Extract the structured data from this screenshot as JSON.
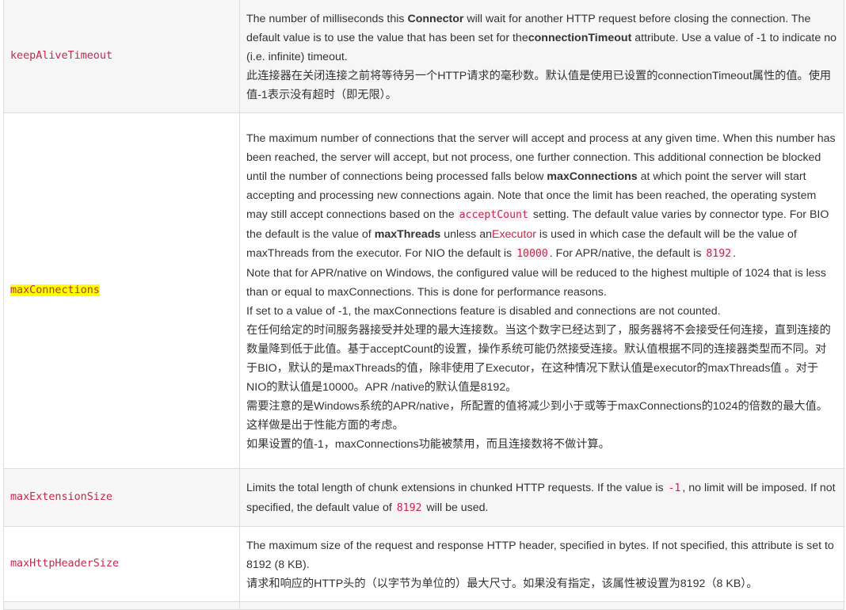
{
  "rows": [
    {
      "name": "keepAliveTimeout",
      "en_1": "The number of milliseconds this ",
      "en_b1": "Connector",
      "en_2": " will wait for another HTTP request before closing the connection. The default value is to use the value that has been set for the",
      "en_b2": "connectionTimeout",
      "en_3": " attribute. Use a value of -1 to indicate no (i.e. infinite) timeout.",
      "zh": "此连接器在关闭连接之前将等待另一个HTTP请求的毫秒数。默认值是使用已设置的connectionTimeout属性的值。使用值-1表示没有超时（即无限）。"
    },
    {
      "name": "maxConnections",
      "p1_a": "The maximum number of connections that the server will accept and process at any given time. When this number has been reached, the server will accept, but not process, one further connection. This additional connection be blocked until the number of connections being processed falls below ",
      "p1_b": "maxConnections",
      "p1_c": " at which point the server will start accepting and processing new connections again. Note that once the limit has been reached, the operating system may still accept connections based on the ",
      "p1_code": "acceptCount",
      "p1_d": " setting. The default value varies by connector type. For BIO the default is the value of ",
      "p1_e": "maxThreads",
      "p1_f": " unless an",
      "p1_link": "Executor",
      "p1_g": " is used in which case the default will be the value of maxThreads from the executor. For NIO the default is ",
      "p1_code2": "10000",
      "p1_h": ". For APR/native, the default is ",
      "p1_code3": "8192",
      "p1_i": ".",
      "p2": "Note that for APR/native on Windows, the configured value will be reduced to the highest multiple of 1024 that is less than or equal to maxConnections. This is done for performance reasons.",
      "p3": "If set to a value of -1, the maxConnections feature is disabled and connections are not counted.",
      "zh1": "在任何给定的时间服务器接受并处理的最大连接数。当这个数字已经达到了，服务器将不会接受任何连接，直到连接的数量降到低于此值。基于acceptCount的设置，操作系统可能仍然接受连接。默认值根据不同的连接器类型而不同。对于BIO，默认的是maxThreads的值，除非使用了Executor，在这种情况下默认值是executor的maxThreads值 。对于NIO的默认值是10000。APR /native的默认值是8192。",
      "zh2": "需要注意的是Windows系统的APR/native，所配置的值将减少到小于或等于maxConnections的1024的倍数的最大值。这样做是出于性能方面的考虑。",
      "zh3": "如果设置的值-1，maxConnections功能被禁用，而且连接数将不做计算。"
    },
    {
      "name": "maxExtensionSize",
      "a": "Limits the total length of chunk extensions in chunked HTTP requests. If the value is ",
      "code1": "-1",
      "b": ", no limit will be imposed. If not specified, the default value of ",
      "code2": "8192",
      "c": " will be used."
    },
    {
      "name": "maxHttpHeaderSize",
      "en": "The maximum size of the request and response HTTP header, specified in bytes. If not specified, this attribute is set to 8192 (8 KB).",
      "zh": "请求和响应的HTTP头的（以字节为单位的）最大尺寸。如果没有指定，该属性被设置为8192（8 KB）。"
    }
  ]
}
